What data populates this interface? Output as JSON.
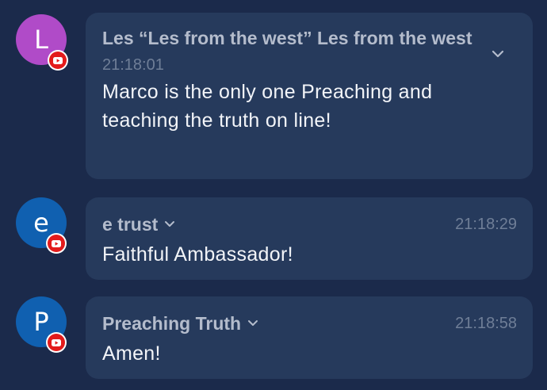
{
  "messages": [
    {
      "avatar_letter": "L",
      "avatar_color": "#b04bc8",
      "author": "Les “Les from the west” Les from the west",
      "timestamp": "21:18:01",
      "text": "Marco is the only one Preaching and teaching the truth on line!",
      "source_icon": "youtube-icon"
    },
    {
      "avatar_letter": "e",
      "avatar_color": "#1060b0",
      "author": "e trust",
      "timestamp": "21:18:29",
      "text": "Faithful Ambassador!",
      "source_icon": "youtube-icon"
    },
    {
      "avatar_letter": "P",
      "avatar_color": "#1060b0",
      "author": "Preaching Truth",
      "timestamp": "21:18:58",
      "text": "Amen!",
      "source_icon": "youtube-icon"
    }
  ],
  "colors": {
    "background": "#1b2a4b",
    "card": "#263a5c",
    "youtube_red": "#e31b1b"
  }
}
